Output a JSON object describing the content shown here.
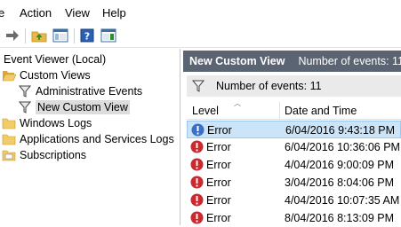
{
  "menu": {
    "items": [
      {
        "label": "e"
      },
      {
        "label": "Action"
      },
      {
        "label": "View"
      },
      {
        "label": "Help"
      }
    ]
  },
  "toolbar": {
    "icons": [
      "forward-arrow-icon",
      "up-folder-icon",
      "show-hide-tree-icon",
      "help-icon",
      "action-pane-icon"
    ]
  },
  "tree": {
    "root": "Event Viewer (Local)",
    "items": [
      {
        "label": "Custom Views"
      },
      {
        "label": "Administrative Events"
      },
      {
        "label": "New Custom View"
      },
      {
        "label": "Windows Logs"
      },
      {
        "label": "Applications and Services Logs"
      },
      {
        "label": "Subscriptions"
      }
    ]
  },
  "header": {
    "title": "New Custom View",
    "count": "Number of events: 11"
  },
  "filter": {
    "text": "Number of events: 11"
  },
  "columns": {
    "level": "Level",
    "datetime": "Date and Time"
  },
  "events": [
    {
      "level": "Error",
      "datetime": "6/04/2016 9:43:18 PM"
    },
    {
      "level": "Error",
      "datetime": "6/04/2016 10:36:06 PM"
    },
    {
      "level": "Error",
      "datetime": "4/04/2016 9:00:09 PM"
    },
    {
      "level": "Error",
      "datetime": "3/04/2016 8:04:06 PM"
    },
    {
      "level": "Error",
      "datetime": "4/04/2016 10:07:35 AM"
    },
    {
      "level": "Error",
      "datetime": "8/04/2016 8:13:09 PM"
    }
  ],
  "colors": {
    "header_bg": "#5a6473",
    "selected_row": "#cce4f7",
    "error_red": "#d0262d",
    "selected_icon_blue": "#3b6fc4"
  }
}
